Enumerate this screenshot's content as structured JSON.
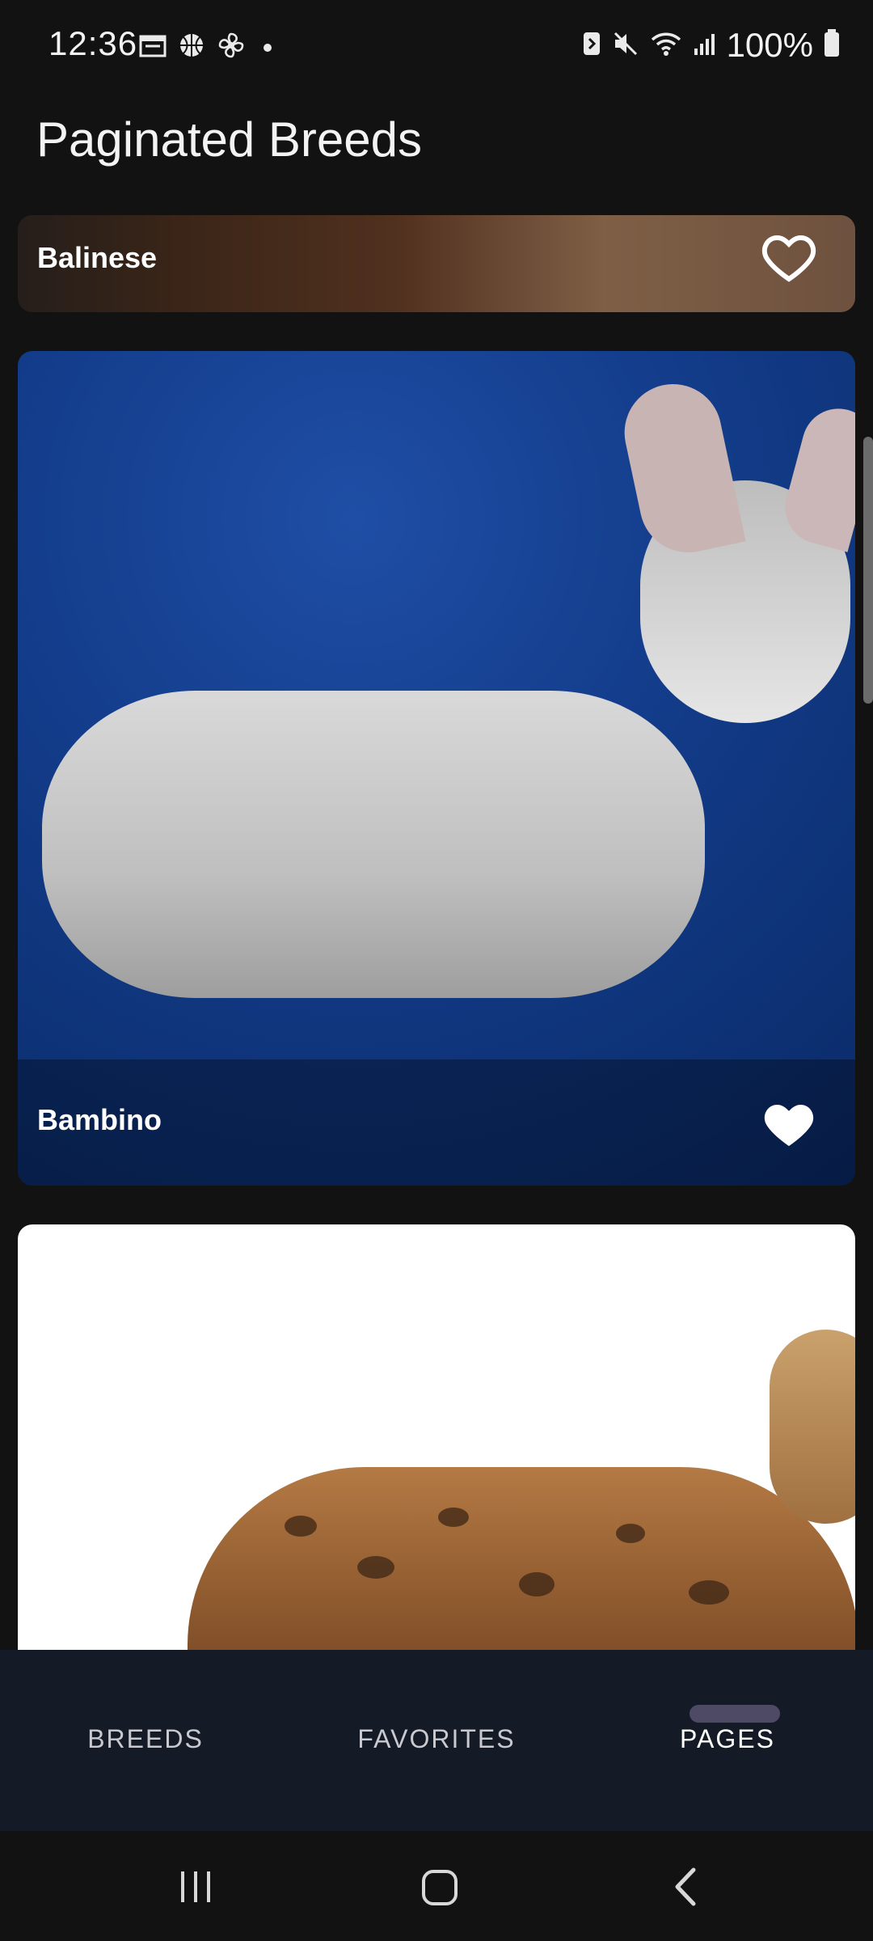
{
  "status": {
    "time": "12:36",
    "battery": "100%"
  },
  "app": {
    "title": "Paginated Breeds"
  },
  "breeds": [
    {
      "name": "Balinese",
      "favorite": false
    },
    {
      "name": "Bambino",
      "favorite": true
    }
  ],
  "bottom_nav": {
    "items": [
      "BREEDS",
      "FAVORITES",
      "PAGES"
    ],
    "selected_index": 2
  },
  "colors": {
    "background": "#121212",
    "bottom_nav": "#141b26",
    "selected_indicator": "#4e4a66",
    "text": "#ffffff"
  },
  "icons": {
    "favorite_outline": "heart-outline-icon",
    "favorite_filled": "heart-filled-icon",
    "nav_recent": "recent-apps-icon",
    "nav_home": "home-icon",
    "nav_back": "back-icon"
  }
}
